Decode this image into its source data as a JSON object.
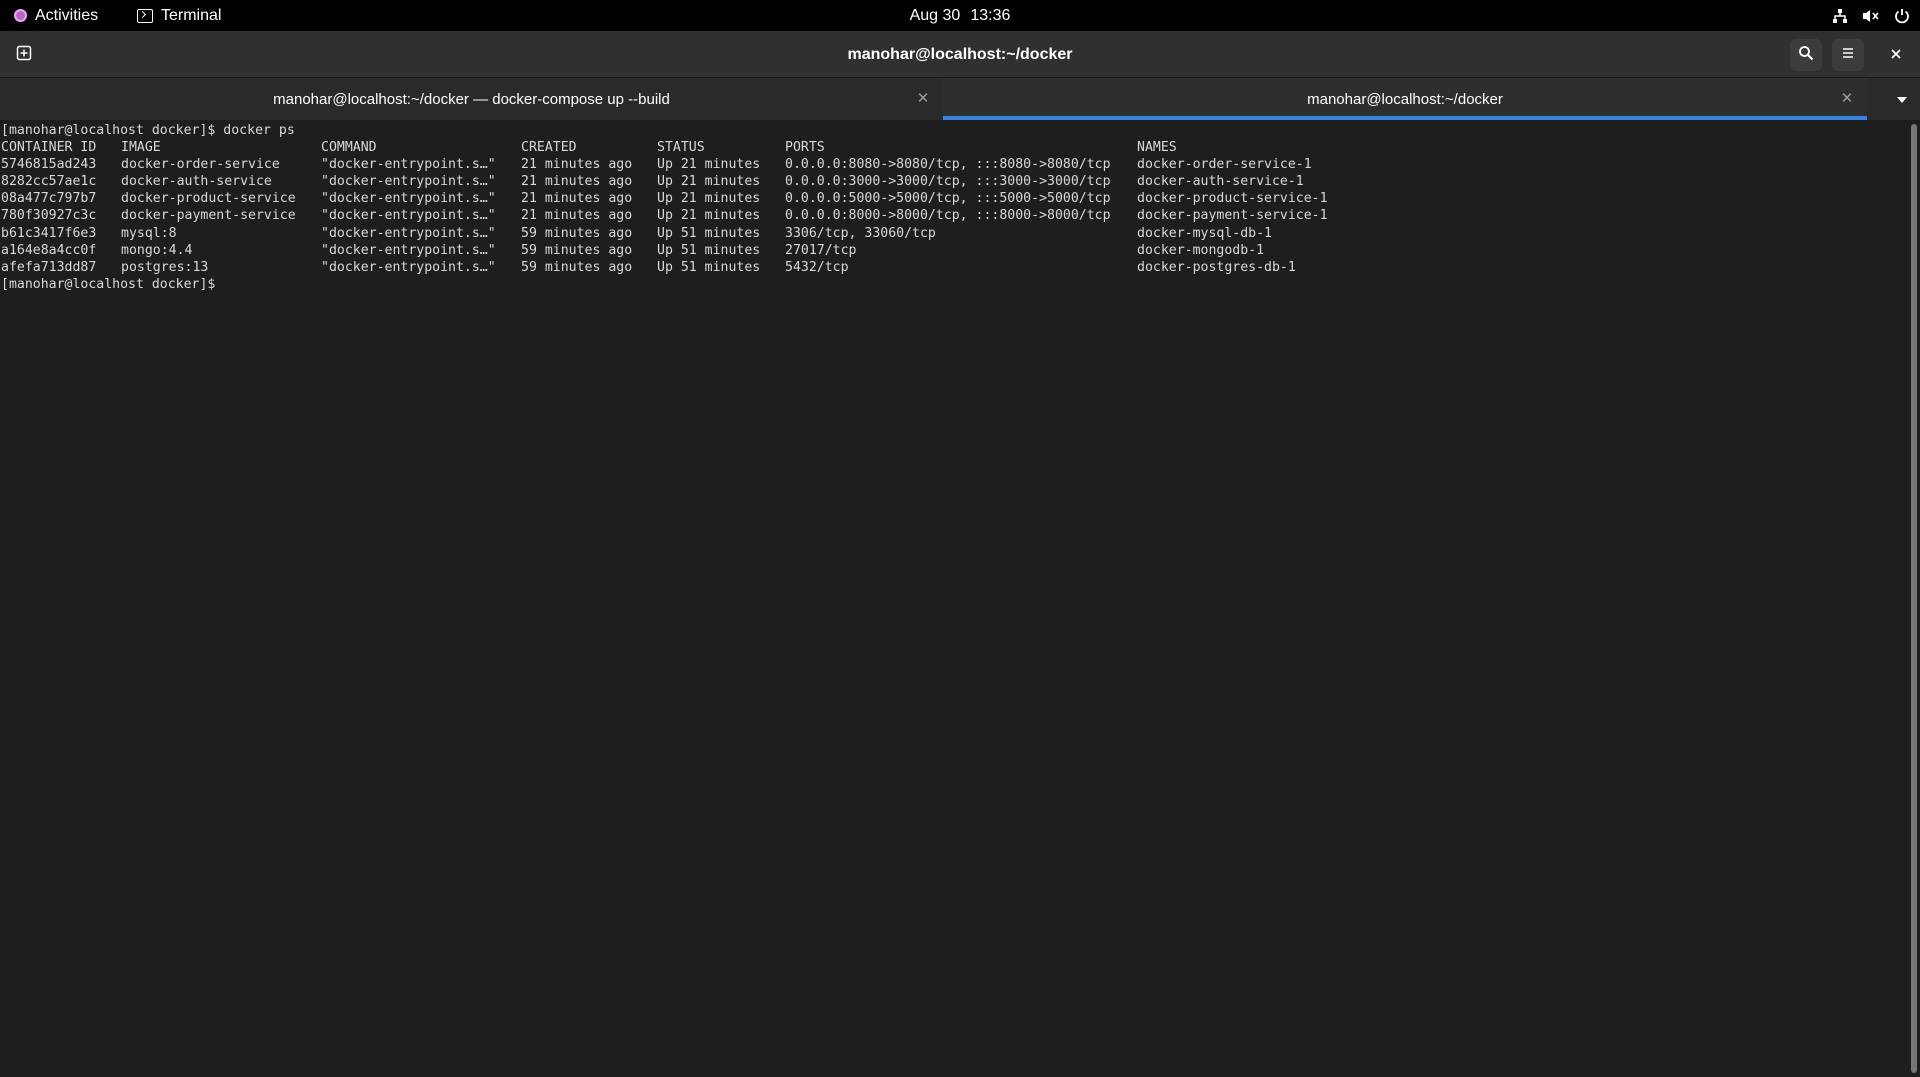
{
  "topbar": {
    "activities": "Activities",
    "app_name": "Terminal",
    "date": "Aug 30",
    "time": "13:36"
  },
  "window": {
    "title": "manohar@localhost:~/docker"
  },
  "tabs": [
    {
      "label": "manohar@localhost:~/docker — docker-compose up --build",
      "active": false
    },
    {
      "label": "manohar@localhost:~/docker",
      "active": true
    }
  ],
  "terminal": {
    "prompt_line": "[manohar@localhost docker]$ docker ps",
    "headers": {
      "id": "CONTAINER ID",
      "image": "IMAGE",
      "command": "COMMAND",
      "created": "CREATED",
      "status": "STATUS",
      "ports": "PORTS",
      "names": "NAMES"
    },
    "rows": [
      {
        "id": "5746815ad243",
        "image": "docker-order-service",
        "command": "\"docker-entrypoint.s…\"",
        "created": "21 minutes ago",
        "status": "Up 21 minutes",
        "ports": "0.0.0.0:8080->8080/tcp, :::8080->8080/tcp",
        "names": "docker-order-service-1"
      },
      {
        "id": "8282cc57ae1c",
        "image": "docker-auth-service",
        "command": "\"docker-entrypoint.s…\"",
        "created": "21 minutes ago",
        "status": "Up 21 minutes",
        "ports": "0.0.0.0:3000->3000/tcp, :::3000->3000/tcp",
        "names": "docker-auth-service-1"
      },
      {
        "id": "08a477c797b7",
        "image": "docker-product-service",
        "command": "\"docker-entrypoint.s…\"",
        "created": "21 minutes ago",
        "status": "Up 21 minutes",
        "ports": "0.0.0.0:5000->5000/tcp, :::5000->5000/tcp",
        "names": "docker-product-service-1"
      },
      {
        "id": "780f30927c3c",
        "image": "docker-payment-service",
        "command": "\"docker-entrypoint.s…\"",
        "created": "21 minutes ago",
        "status": "Up 21 minutes",
        "ports": "0.0.0.0:8000->8000/tcp, :::8000->8000/tcp",
        "names": "docker-payment-service-1"
      },
      {
        "id": "b61c3417f6e3",
        "image": "mysql:8",
        "command": "\"docker-entrypoint.s…\"",
        "created": "59 minutes ago",
        "status": "Up 51 minutes",
        "ports": "3306/tcp, 33060/tcp",
        "names": "docker-mysql-db-1"
      },
      {
        "id": "a164e8a4cc0f",
        "image": "mongo:4.4",
        "command": "\"docker-entrypoint.s…\"",
        "created": "59 minutes ago",
        "status": "Up 51 minutes",
        "ports": "27017/tcp",
        "names": "docker-mongodb-1"
      },
      {
        "id": "afefa713dd87",
        "image": "postgres:13",
        "command": "\"docker-entrypoint.s…\"",
        "created": "59 minutes ago",
        "status": "Up 51 minutes",
        "ports": "5432/tcp",
        "names": "docker-postgres-db-1"
      }
    ],
    "final_prompt": "[manohar@localhost docker]$"
  },
  "icons": {
    "new_tab": "new-tab-icon",
    "search": "search-icon",
    "menu": "hamburger-menu-icon",
    "close": "close-icon",
    "network": "network-icon",
    "volume": "volume-muted-icon",
    "power": "power-icon",
    "tab_dropdown": "chevron-down-icon"
  },
  "colors": {
    "accent": "#3584e4",
    "terminal_bg": "#1e1e1e",
    "terminal_fg": "#d8d8d8",
    "headerbar_bg": "#303030",
    "topbar_bg": "#000000"
  }
}
